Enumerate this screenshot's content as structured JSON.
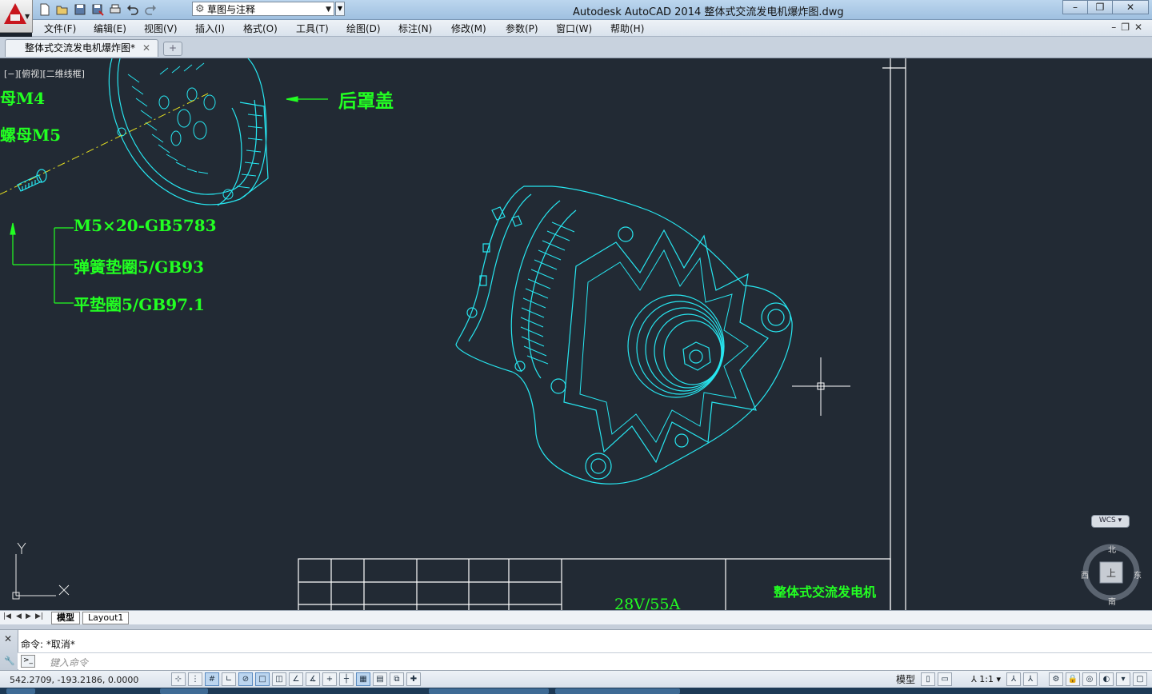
{
  "app": {
    "title": "Autodesk AutoCAD 2014    整体式交流发电机爆炸图.dwg",
    "workspace": "草图与注释"
  },
  "menus": [
    "文件(F)",
    "编辑(E)",
    "视图(V)",
    "插入(I)",
    "格式(O)",
    "工具(T)",
    "绘图(D)",
    "标注(N)",
    "修改(M)",
    "参数(P)",
    "窗口(W)",
    "帮助(H)"
  ],
  "file_tab": {
    "label": "整体式交流发电机爆炸图*"
  },
  "viewport": {
    "label": "[−][俯视][二维线框]",
    "annotations": {
      "nut_m4": "母M4",
      "nut_m5": "螺母M5",
      "rear_cover": "后罩盖",
      "bolt": "M5×20-GB5783",
      "spring_washer": "弹簧垫圈5/GB93",
      "flat_washer": "平垫圈5/GB97.1",
      "title_block_name": "整体式交流发电机",
      "rating": "28V/55A"
    },
    "ucs": {
      "y": "Y",
      "x": "X"
    },
    "viewcube": {
      "wcs": "WCS",
      "north": "北",
      "south": "南",
      "east": "东",
      "west": "西",
      "face": "上"
    }
  },
  "layout_tabs": [
    {
      "label": "模型",
      "active": true
    },
    {
      "label": "Layout1",
      "active": false
    }
  ],
  "command": {
    "history": "命令: *取消*",
    "placeholder": "键入命令"
  },
  "status": {
    "coords": "542.2709,  -193.2186,  0.0000",
    "model_label": "模型",
    "scale": "1:1"
  },
  "colors": {
    "drawing_bg": "#222a34",
    "wireframe": "#27e6f0",
    "annotation": "#22ff22",
    "frame": "#ffffff"
  }
}
